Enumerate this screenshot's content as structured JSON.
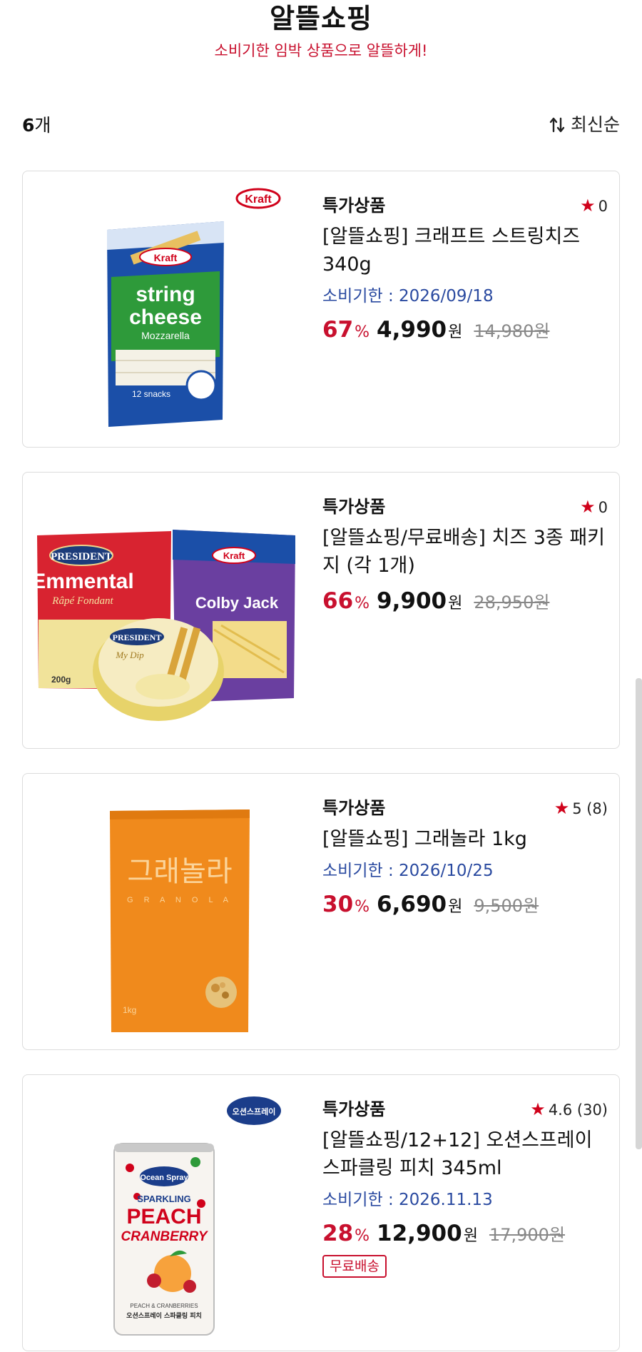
{
  "header": {
    "title": "알뜰쇼핑",
    "subtitle": "소비기한 임박 상품으로 알뜰하게!"
  },
  "toolbar": {
    "count_number": "6",
    "count_unit": "개",
    "sort_label": "최신순",
    "sort_icon": "sort-arrows-icon"
  },
  "products": [
    {
      "badge": "특가상품",
      "rating": "0",
      "name": "[알뜰쇼핑] 크래프트 스트링치즈 340g",
      "expiry": "소비기한 : 2026/09/18",
      "discount": "67",
      "price": "4,990",
      "original_price": "14,980원",
      "image_texts": [
        "Kraft",
        "string",
        "cheese",
        "Mozzarella",
        "12 snacks",
        "Kraft"
      ]
    },
    {
      "badge": "특가상품",
      "rating": "0",
      "name": "[알뜰쇼핑/무료배송] 치즈 3종 패키지 (각 1개)",
      "discount": "66",
      "price": "9,900",
      "original_price": "28,950원",
      "image_texts": [
        "PRESIDENT",
        "Emmental",
        "Râpé Fondant",
        "200g",
        "Kraft",
        "Colby Jack",
        "PRESIDENT",
        "My Dip"
      ]
    },
    {
      "badge": "특가상품",
      "rating": "5 (8)",
      "name": "[알뜰쇼핑] 그래놀라 1kg",
      "expiry": "소비기한 : 2026/10/25",
      "discount": "30",
      "price": "6,690",
      "original_price": "9,500원",
      "image_texts": [
        "그래놀라",
        "G R A N O L A",
        "1kg"
      ]
    },
    {
      "badge": "특가상품",
      "rating": "4.6 (30)",
      "name": "[알뜰쇼핑/12+12] 오션스프레이 스파클링 피치 345ml",
      "expiry": "소비기한 : 2026.11.13",
      "discount": "28",
      "price": "12,900",
      "original_price": "17,900원",
      "tag": "무료배송",
      "image_texts": [
        "오션스프레이",
        "Ocean Spray",
        "SPARKLING",
        "PEACH",
        "CRANBERRY",
        "PEACH & CRANBERRIES",
        "오션스프레이 스파클링 피치"
      ]
    }
  ],
  "labels": {
    "percent": "%",
    "won": "원"
  },
  "colors": {
    "accent_red": "#c8102e",
    "expiry_blue": "#2a4aa0",
    "kraft_blue": "#1b4fa8",
    "granola_orange": "#f08a1c"
  }
}
